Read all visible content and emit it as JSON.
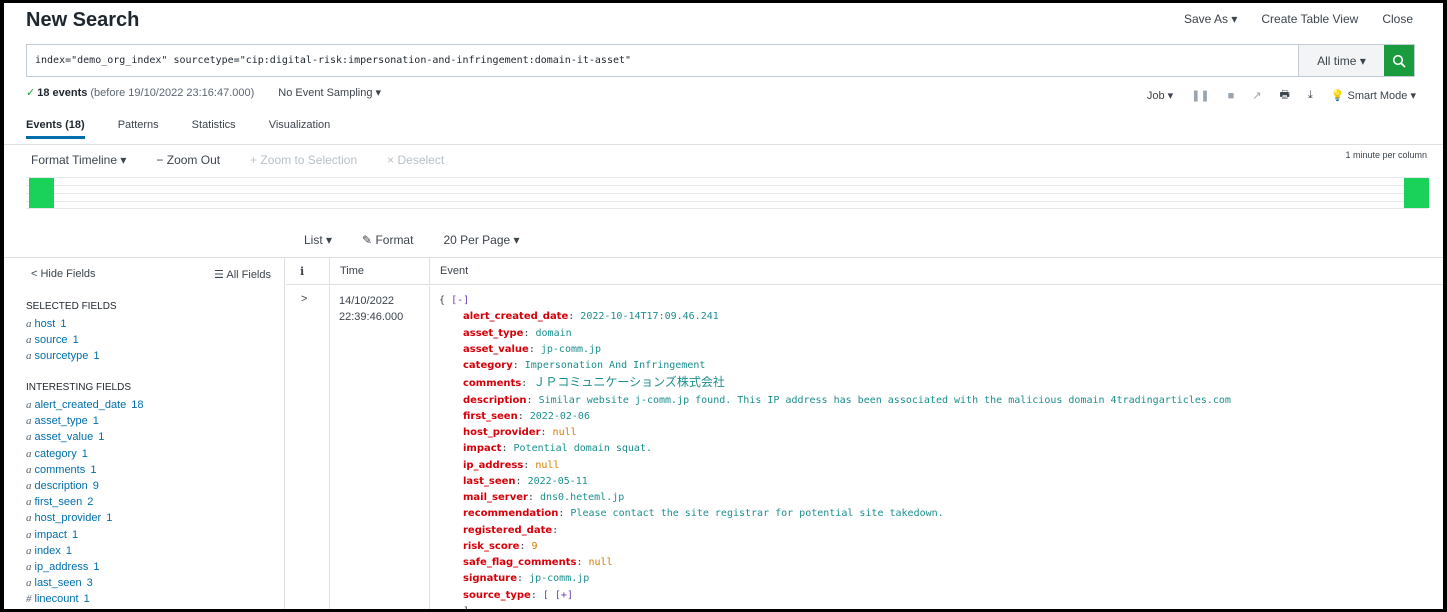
{
  "header": {
    "title": "New Search",
    "save_as": "Save As ▾",
    "create_table_view": "Create Table View",
    "close": "Close"
  },
  "search": {
    "query": "index=\"demo_org_index\" sourcetype=\"cip:digital-risk:impersonation-and-infringement:domain-it-asset\"",
    "time_range": "All time ▾"
  },
  "status": {
    "event_count": "18 events",
    "event_suffix": "(before 19/10/2022 23:16:47.000)",
    "sampling": "No Event Sampling ▾",
    "job": "Job ▾",
    "mode": "Smart Mode ▾"
  },
  "tabs": [
    "Events (18)",
    "Patterns",
    "Statistics",
    "Visualization"
  ],
  "timeline": {
    "format": "Format Timeline ▾",
    "zoom_out": "− Zoom Out",
    "zoom_sel": "+ Zoom to Selection",
    "deselect": "× Deselect",
    "per_column": "1 minute per column"
  },
  "list_tools": {
    "list": "List ▾",
    "format": "Format",
    "per_page": "20 Per Page ▾"
  },
  "sidebar": {
    "hide": "< Hide Fields",
    "all": "All Fields",
    "selected_title": "SELECTED FIELDS",
    "selected": [
      {
        "type": "a",
        "name": "host",
        "count": "1"
      },
      {
        "type": "a",
        "name": "source",
        "count": "1"
      },
      {
        "type": "a",
        "name": "sourcetype",
        "count": "1"
      }
    ],
    "interesting_title": "INTERESTING FIELDS",
    "interesting": [
      {
        "type": "a",
        "name": "alert_created_date",
        "count": "18"
      },
      {
        "type": "a",
        "name": "asset_type",
        "count": "1"
      },
      {
        "type": "a",
        "name": "asset_value",
        "count": "1"
      },
      {
        "type": "a",
        "name": "category",
        "count": "1"
      },
      {
        "type": "a",
        "name": "comments",
        "count": "1"
      },
      {
        "type": "a",
        "name": "description",
        "count": "9"
      },
      {
        "type": "a",
        "name": "first_seen",
        "count": "2"
      },
      {
        "type": "a",
        "name": "host_provider",
        "count": "1"
      },
      {
        "type": "a",
        "name": "impact",
        "count": "1"
      },
      {
        "type": "a",
        "name": "index",
        "count": "1"
      },
      {
        "type": "a",
        "name": "ip_address",
        "count": "1"
      },
      {
        "type": "a",
        "name": "last_seen",
        "count": "3"
      },
      {
        "type": "#",
        "name": "linecount",
        "count": "1"
      }
    ]
  },
  "events": {
    "headers": {
      "i": "i",
      "time": "Time",
      "event": "Event"
    },
    "row": {
      "expand": ">",
      "date": "14/10/2022",
      "time": "22:39:46.000",
      "open": "{",
      "toggle": "[-]",
      "fields": [
        {
          "k": "alert_created_date",
          "v": "2022-10-14T17:09.46.241",
          "t": "str"
        },
        {
          "k": "asset_type",
          "v": "domain",
          "t": "str"
        },
        {
          "k": "asset_value",
          "v": "jp-comm.jp",
          "t": "str"
        },
        {
          "k": "category",
          "v": "Impersonation And Infringement",
          "t": "str"
        },
        {
          "k": "comments",
          "v": "ＪＰコミュニケーションズ株式会社",
          "t": "jp"
        },
        {
          "k": "description",
          "v": "Similar website j-comm.jp found. This IP address has been associated with the malicious domain 4tradingarticles.com",
          "t": "str"
        },
        {
          "k": "first_seen",
          "v": "2022-02-06",
          "t": "str"
        },
        {
          "k": "host_provider",
          "v": "null",
          "t": "null"
        },
        {
          "k": "impact",
          "v": "Potential domain squat.",
          "t": "str"
        },
        {
          "k": "ip_address",
          "v": "null",
          "t": "null"
        },
        {
          "k": "last_seen",
          "v": "2022-05-11",
          "t": "str"
        },
        {
          "k": "mail_server",
          "v": "dns0.heteml.jp",
          "t": "str"
        },
        {
          "k": "recommendation",
          "v": "Please contact the site registrar for potential site takedown.",
          "t": "str"
        },
        {
          "k": "registered_date",
          "v": "",
          "t": "str"
        },
        {
          "k": "risk_score",
          "v": "9",
          "t": "num"
        },
        {
          "k": "safe_flag_comments",
          "v": "null",
          "t": "null"
        },
        {
          "k": "signature",
          "v": "jp-comm.jp",
          "t": "str"
        },
        {
          "k": "source_type",
          "v": "[ [+]",
          "t": "tog"
        }
      ],
      "trail": "]"
    }
  },
  "colors": {
    "accent": "#006eaa",
    "search_button": "#1a9c3e",
    "timeline_bar": "#1ad15a",
    "json_key": "#d6000a"
  }
}
